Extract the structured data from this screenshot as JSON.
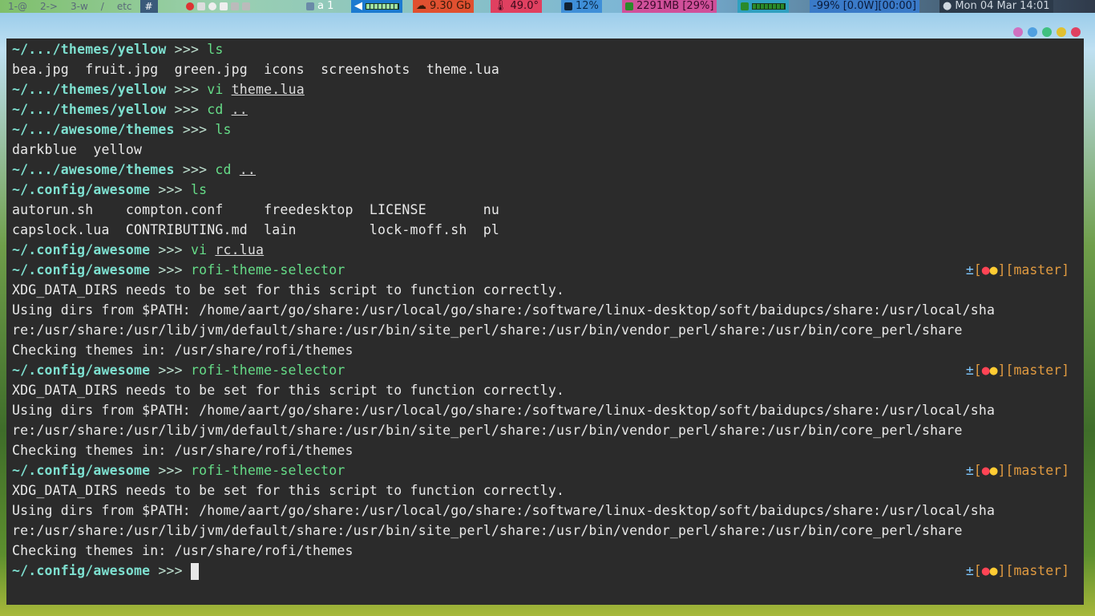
{
  "topbar": {
    "tags": [
      "1-@",
      "2->",
      "3-w",
      "/",
      "etc",
      "#"
    ],
    "layout_label": "a 1",
    "disk": "9.30 Gb",
    "temp": "49.0°",
    "cpu": "12%",
    "mem": "2291MB [29%]",
    "battery": "-99% [0.0W][00:00]",
    "date": "Mon 04 Mar",
    "time": "14:01"
  },
  "terminal": {
    "lines": [
      {
        "type": "prompt",
        "path": "~/.../themes/yellow",
        "cmd": "ls",
        "arg": ""
      },
      {
        "type": "out",
        "text": "bea.jpg  fruit.jpg  green.jpg  icons  screenshots  theme.lua"
      },
      {
        "type": "prompt",
        "path": "~/.../themes/yellow",
        "cmd": "vi",
        "arg": "theme.lua"
      },
      {
        "type": "prompt",
        "path": "~/.../themes/yellow",
        "cmd": "cd",
        "arg": ".."
      },
      {
        "type": "prompt",
        "path": "~/.../awesome/themes",
        "cmd": "ls",
        "arg": ""
      },
      {
        "type": "out",
        "text": "darkblue  yellow"
      },
      {
        "type": "prompt",
        "path": "~/.../awesome/themes",
        "cmd": "cd",
        "arg": ".."
      },
      {
        "type": "prompt",
        "path": "~/.config/awesome",
        "cmd": "ls",
        "arg": ""
      },
      {
        "type": "out",
        "text": "autorun.sh    compton.conf     freedesktop  LICENSE       nu"
      },
      {
        "type": "out",
        "text": "capslock.lua  CONTRIBUTING.md  lain         lock-moff.sh  pl"
      },
      {
        "type": "prompt",
        "path": "~/.config/awesome",
        "cmd": "vi",
        "arg": "rc.lua"
      },
      {
        "type": "prompt",
        "path": "~/.config/awesome",
        "cmd": "rofi-theme-selector",
        "arg": "",
        "right": true
      },
      {
        "type": "out",
        "text": "XDG_DATA_DIRS needs to be set for this script to function correctly."
      },
      {
        "type": "out",
        "text": "Using dirs from $PATH: /home/aart/go/share:/usr/local/go/share:/software/linux-desktop/soft/baidupcs/share:/usr/local/sha"
      },
      {
        "type": "out",
        "text": "re:/usr/share:/usr/lib/jvm/default/share:/usr/bin/site_perl/share:/usr/bin/vendor_perl/share:/usr/bin/core_perl/share"
      },
      {
        "type": "out",
        "text": "Checking themes in: /usr/share/rofi/themes"
      },
      {
        "type": "prompt",
        "path": "~/.config/awesome",
        "cmd": "rofi-theme-selector",
        "arg": "",
        "right": true
      },
      {
        "type": "out",
        "text": "XDG_DATA_DIRS needs to be set for this script to function correctly."
      },
      {
        "type": "out",
        "text": "Using dirs from $PATH: /home/aart/go/share:/usr/local/go/share:/software/linux-desktop/soft/baidupcs/share:/usr/local/sha"
      },
      {
        "type": "out",
        "text": "re:/usr/share:/usr/lib/jvm/default/share:/usr/bin/site_perl/share:/usr/bin/vendor_perl/share:/usr/bin/core_perl/share"
      },
      {
        "type": "out",
        "text": "Checking themes in: /usr/share/rofi/themes"
      },
      {
        "type": "prompt",
        "path": "~/.config/awesome",
        "cmd": "rofi-theme-selector",
        "arg": "",
        "right": true
      },
      {
        "type": "out",
        "text": "XDG_DATA_DIRS needs to be set for this script to function correctly."
      },
      {
        "type": "out",
        "text": "Using dirs from $PATH: /home/aart/go/share:/usr/local/go/share:/software/linux-desktop/soft/baidupcs/share:/usr/local/sha"
      },
      {
        "type": "out",
        "text": "re:/usr/share:/usr/lib/jvm/default/share:/usr/bin/site_perl/share:/usr/bin/vendor_perl/share:/usr/bin/core_perl/share"
      },
      {
        "type": "out",
        "text": "Checking themes in: /usr/share/rofi/themes"
      },
      {
        "type": "prompt",
        "path": "~/.config/awesome",
        "cmd": "",
        "arg": "",
        "right": true,
        "cursor": true
      }
    ],
    "prompt_symbol": ">>>",
    "git": {
      "plus": "±",
      "dots": "●●",
      "branch": "master"
    }
  }
}
